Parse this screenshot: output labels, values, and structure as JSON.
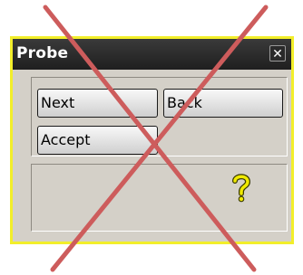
{
  "window": {
    "title": "Probe",
    "close_label": "✕"
  },
  "buttons": {
    "next": "Next",
    "back": "Back",
    "accept": "Accept"
  },
  "icons": {
    "close": "close-icon",
    "help": "question-mark-icon",
    "overlay": "red-cross-overlay"
  },
  "colors": {
    "window_border": "#f2ee2a",
    "titlebar": "#2a2a2a",
    "cross": "#cd5c5c",
    "help_icon": "#e8e000"
  }
}
